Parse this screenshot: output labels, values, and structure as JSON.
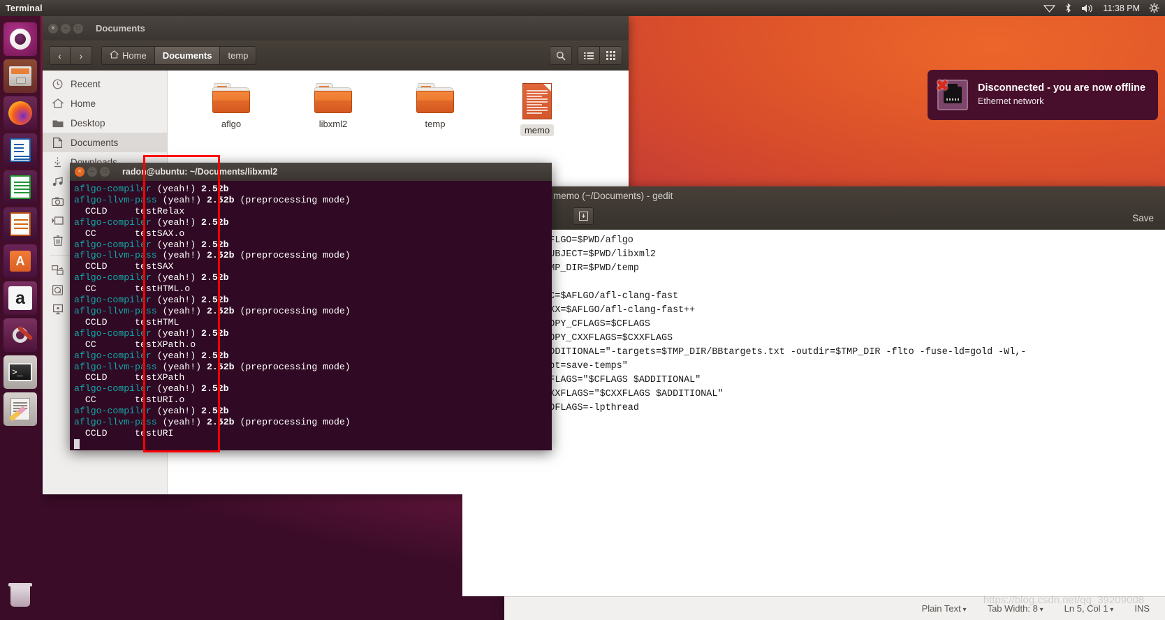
{
  "panel": {
    "app_title": "Terminal",
    "clock": "11:38 PM",
    "icons": [
      "wifi-icon",
      "bluetooth-icon",
      "volume-icon",
      "gear-icon"
    ]
  },
  "launcher": {
    "items": [
      {
        "name": "ubuntu-dash",
        "label": "Dash"
      },
      {
        "name": "files",
        "label": "Files"
      },
      {
        "name": "firefox",
        "label": "Firefox"
      },
      {
        "name": "libreoffice-writer",
        "label": "LibreOffice Writer"
      },
      {
        "name": "libreoffice-calc",
        "label": "LibreOffice Calc"
      },
      {
        "name": "libreoffice-impress",
        "label": "LibreOffice Impress"
      },
      {
        "name": "ubuntu-software",
        "label": "Ubuntu Software"
      },
      {
        "name": "amazon",
        "label": "Amazon"
      },
      {
        "name": "system-settings",
        "label": "System Settings"
      },
      {
        "name": "terminal",
        "label": "Terminal"
      },
      {
        "name": "gedit",
        "label": "Text Editor"
      }
    ],
    "trash_label": "Trash"
  },
  "nautilus": {
    "title": "Documents",
    "breadcrumbs": [
      {
        "label": "Home",
        "active": false,
        "icon": "home-icon"
      },
      {
        "label": "Documents",
        "active": true,
        "icon": ""
      },
      {
        "label": "temp",
        "active": false,
        "icon": ""
      }
    ],
    "toolbar_icons": [
      "search-icon",
      "list-view-icon",
      "grid-view-icon"
    ],
    "sidebar": [
      {
        "label": "Recent",
        "icon": "clock-icon",
        "selected": false
      },
      {
        "label": "Home",
        "icon": "home-icon",
        "selected": false
      },
      {
        "label": "Desktop",
        "icon": "folder-icon",
        "selected": false
      },
      {
        "label": "Documents",
        "icon": "document-icon",
        "selected": true
      },
      {
        "label": "Downloads",
        "icon": "download-icon",
        "selected": false
      },
      {
        "label": "Music",
        "icon": "music-icon",
        "selected": false
      },
      {
        "label": "Pictures",
        "icon": "camera-icon",
        "selected": false
      },
      {
        "label": "Videos",
        "icon": "video-icon",
        "selected": false
      },
      {
        "label": "Trash",
        "icon": "trash-icon",
        "selected": false
      },
      {
        "label": "Network",
        "icon": "network-icon",
        "selected": false
      },
      {
        "label": "Computer",
        "icon": "disk-icon",
        "selected": false
      },
      {
        "label": "Connect to Server",
        "icon": "server-icon",
        "selected": false
      }
    ],
    "files": [
      {
        "name": "aflgo",
        "type": "folder",
        "selected": false
      },
      {
        "name": "libxml2",
        "type": "folder",
        "selected": false
      },
      {
        "name": "temp",
        "type": "folder",
        "selected": false
      },
      {
        "name": "memo",
        "type": "document",
        "selected": true
      }
    ]
  },
  "terminal": {
    "title": "radon@ubuntu: ~/Documents/libxml2",
    "lines": [
      {
        "cmd": "aflgo-compiler",
        "rest": " (yeah!) ",
        "ver": "2.52b",
        "tail": ""
      },
      {
        "cmd": "aflgo-llvm-pass",
        "rest": " (yeah!) ",
        "ver": "2.52b",
        "tail": " (preprocessing mode)"
      },
      {
        "plain": "  CCLD     testRelax"
      },
      {
        "cmd": "aflgo-compiler",
        "rest": " (yeah!) ",
        "ver": "2.52b",
        "tail": ""
      },
      {
        "plain": "  CC       testSAX.o"
      },
      {
        "cmd": "aflgo-compiler",
        "rest": " (yeah!) ",
        "ver": "2.52b",
        "tail": ""
      },
      {
        "cmd": "aflgo-llvm-pass",
        "rest": " (yeah!) ",
        "ver": "2.52b",
        "tail": " (preprocessing mode)"
      },
      {
        "plain": "  CCLD     testSAX"
      },
      {
        "cmd": "aflgo-compiler",
        "rest": " (yeah!) ",
        "ver": "2.52b",
        "tail": ""
      },
      {
        "plain": "  CC       testHTML.o"
      },
      {
        "cmd": "aflgo-compiler",
        "rest": " (yeah!) ",
        "ver": "2.52b",
        "tail": ""
      },
      {
        "cmd": "aflgo-llvm-pass",
        "rest": " (yeah!) ",
        "ver": "2.52b",
        "tail": " (preprocessing mode)"
      },
      {
        "plain": "  CCLD     testHTML"
      },
      {
        "cmd": "aflgo-compiler",
        "rest": " (yeah!) ",
        "ver": "2.52b",
        "tail": ""
      },
      {
        "plain": "  CC       testXPath.o"
      },
      {
        "cmd": "aflgo-compiler",
        "rest": " (yeah!) ",
        "ver": "2.52b",
        "tail": ""
      },
      {
        "cmd": "aflgo-llvm-pass",
        "rest": " (yeah!) ",
        "ver": "2.52b",
        "tail": " (preprocessing mode)"
      },
      {
        "plain": "  CCLD     testXPath"
      },
      {
        "cmd": "aflgo-compiler",
        "rest": " (yeah!) ",
        "ver": "2.52b",
        "tail": ""
      },
      {
        "plain": "  CC       testURI.o"
      },
      {
        "cmd": "aflgo-compiler",
        "rest": " (yeah!) ",
        "ver": "2.52b",
        "tail": ""
      },
      {
        "cmd": "aflgo-llvm-pass",
        "rest": " (yeah!) ",
        "ver": "2.52b",
        "tail": " (preprocessing mode)"
      },
      {
        "plain": "  CCLD     testURI"
      }
    ]
  },
  "gedit": {
    "title": "memo (~/Documents) - gedit",
    "save_label": "Save",
    "toolbar_icon": "open-icon",
    "content": "export AFLGO=$PWD/aflgo\nexport SUBJECT=$PWD/libxml2\nexport TMP_DIR=$PWD/temp\n\nexport CC=$AFLGO/afl-clang-fast\nexport CXX=$AFLGO/afl-clang-fast++\nexport COPY_CFLAGS=$CFLAGS\nexport COPY_CXXFLAGS=$CXXFLAGS\nexport ADDITIONAL=\"-targets=$TMP_DIR/BBtargets.txt -outdir=$TMP_DIR -flto -fuse-ld=gold -Wl,-\nplugin-opt=save-temps\"\nexport CFLAGS=\"$CFLAGS $ADDITIONAL\"\nexport CXXFLAGS=\"$CXXFLAGS $ADDITIONAL\"\nexport LDFLAGS=-lpthread",
    "status": {
      "language": "Plain Text",
      "tab_width": "Tab Width: 8",
      "position": "Ln 5, Col 1",
      "mode": "INS"
    }
  },
  "notification": {
    "title": "Disconnected - you are now offline",
    "subtitle": "Ethernet network",
    "icon": "ethernet-disconnected-icon"
  },
  "watermark": "https://blog.csdn.net/qq_39209008",
  "colors": {
    "terminal_bg": "#300a24",
    "terminal_cyan": "#12a7a7",
    "annotation_red": "#fe0000",
    "folder_orange": "#e2692a"
  }
}
